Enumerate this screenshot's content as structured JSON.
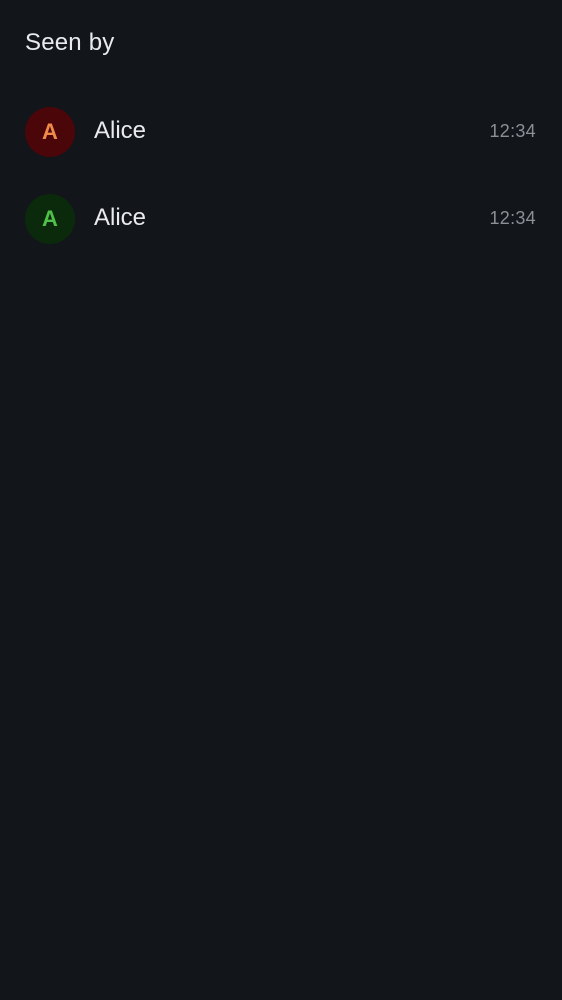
{
  "header": {
    "title": "Seen by"
  },
  "readers": [
    {
      "initial": "A",
      "name": "Alice",
      "time": "12:34",
      "avatar_bg": "#4a0608",
      "avatar_fg": "#f0894a"
    },
    {
      "initial": "A",
      "name": "Alice",
      "time": "12:34",
      "avatar_bg": "#0b2a0b",
      "avatar_fg": "#4fc04a"
    }
  ],
  "colors": {
    "background": "#12151a",
    "primary_text": "#e8eaed",
    "secondary_text": "#8b9096"
  }
}
